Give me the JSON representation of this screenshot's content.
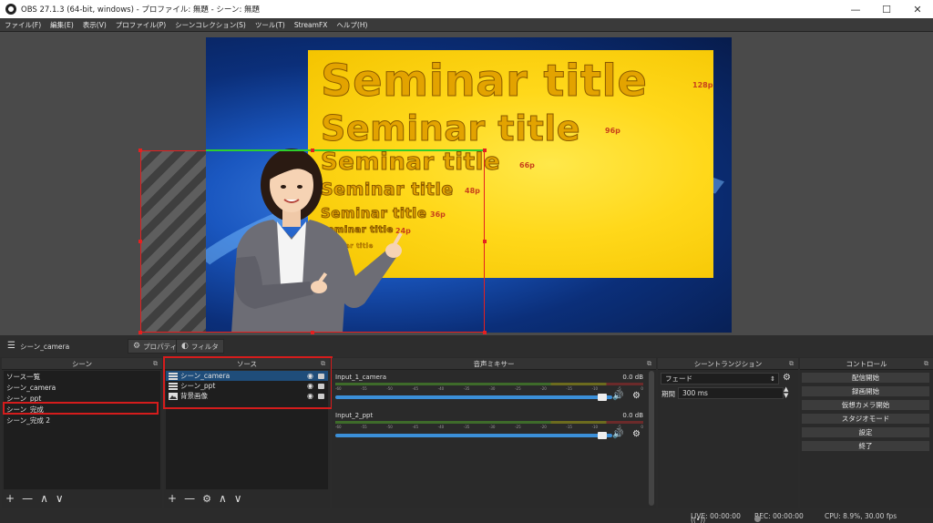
{
  "window": {
    "title": "OBS 27.1.3 (64-bit, windows) - プロファイル: 無題 - シーン: 無題",
    "minimize": "—",
    "maximize": "☐",
    "close": "✕"
  },
  "menu": [
    "ファイル(F)",
    "編集(E)",
    "表示(V)",
    "プロファイル(P)",
    "シーンコレクション(S)",
    "ツール(T)",
    "StreamFX",
    "ヘルプ(H)"
  ],
  "preview": {
    "slide_titles": [
      {
        "text": "Seminar title",
        "size": "128p"
      },
      {
        "text": "Seminar title",
        "size": "96p"
      },
      {
        "text": "Seminar title",
        "size": "66p"
      },
      {
        "text": "Seminar title",
        "size": "48p"
      },
      {
        "text": "Seminar title",
        "size": "36p"
      },
      {
        "text": "Seminar title",
        "size": "24p"
      },
      {
        "text": "Seminar title",
        "size": ""
      }
    ]
  },
  "dock": {
    "current_scene": "シーン_camera",
    "properties": "プロパティ",
    "filters": "フィルタ"
  },
  "scenes": {
    "title": "シーン",
    "items": [
      "ソース一覧",
      "シーン_camera",
      "シーン_ppt",
      "シーン_完成",
      "シーン_完成 2"
    ],
    "selected_index": 3,
    "toolbar": [
      "+",
      "—",
      "∧",
      "∨"
    ]
  },
  "sources": {
    "title": "ソース",
    "items": [
      {
        "name": "シーン_camera",
        "icon": "scene-icon",
        "visible": true,
        "locked": true
      },
      {
        "name": "シーン_ppt",
        "icon": "scene-icon",
        "visible": true,
        "locked": true
      },
      {
        "name": "背景画像",
        "icon": "image-icon",
        "visible": true,
        "locked": true
      }
    ],
    "selected_index": 0,
    "toolbar": [
      "+",
      "—",
      "⚙",
      "∧",
      "∨"
    ]
  },
  "mixer": {
    "title": "音声ミキサー",
    "ticks": [
      "-60",
      "-55",
      "-50",
      "-45",
      "-40",
      "-35",
      "-30",
      "-25",
      "-20",
      "-15",
      "-10",
      "-5",
      "0"
    ],
    "channels": [
      {
        "name": "Input_1_camera",
        "db": "0.0 dB",
        "volume": 1.0
      },
      {
        "name": "Input_2_ppt",
        "db": "0.0 dB",
        "volume": 1.0
      }
    ]
  },
  "transitions": {
    "title": "シーントランジション",
    "selected": "フェード",
    "duration_label": "期間",
    "duration_value": "300 ms"
  },
  "controls": {
    "title": "コントロール",
    "buttons": [
      "配信開始",
      "録画開始",
      "仮想カメラ開始",
      "スタジオモード",
      "設定",
      "終了"
    ]
  },
  "status": {
    "live": "LIVE: 00:00:00",
    "rec": "REC: 00:00:00",
    "cpu": "CPU: 8.9%, 30.00 fps"
  },
  "colors": {
    "accent_blue": "#3b8fd8",
    "highlight_red": "#d51c1c",
    "slide_yellow": "#ffd81a"
  }
}
